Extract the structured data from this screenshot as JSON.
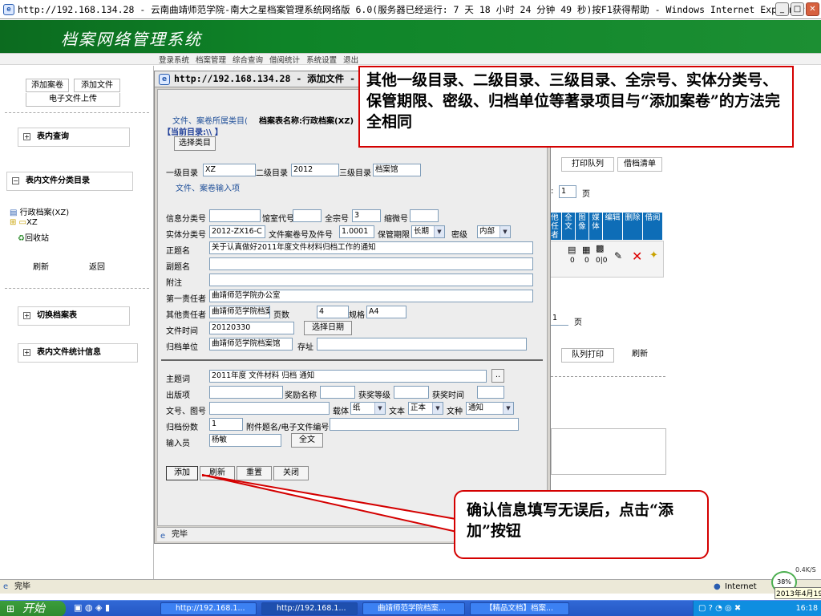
{
  "browser": {
    "title": "http://192.168.134.28 - 云南曲靖师范学院-南大之星档案管理系统网络版 6.0(服务器已经运行: 7 天 18 小时 24 分钟 49 秒)按F1获得帮助 - Windows Internet Explorer",
    "status_text": "完毕",
    "zone_text": "Internet"
  },
  "app": {
    "title": "档案网络管理系统",
    "nav": [
      "登录系统",
      "档案管理",
      "综合查询",
      "借阅统计",
      "系统设置",
      "退出"
    ]
  },
  "sidebar": {
    "add_volume": "添加案卷",
    "add_file": "添加文件",
    "e_file_upload": "电子文件上传",
    "table_query": "表内查询",
    "table_category": "表内文件分类目录",
    "tree_root": "行政档案(XZ)",
    "tree_child": "XZ",
    "tree_recycle": "回收站",
    "refresh": "刷新",
    "back": "返回",
    "switch_table": "切换档案表",
    "table_stats": "表内文件统计信息"
  },
  "background": {
    "print_queue": "打印队列",
    "loan_list": "借档清单",
    "page_prefix": ":",
    "page_value": "1",
    "page_suffix": "页",
    "grid_headers": [
      "他任者",
      "全文",
      "图像",
      "媒体",
      "编辑",
      "删除",
      "借阅"
    ],
    "counts": [
      "0",
      "0",
      "0|0"
    ],
    "page_value2": "1",
    "page_suffix2": "页",
    "queue_print": "队列打印",
    "refresh": "刷新"
  },
  "popup": {
    "title": "http://192.168.134.28 - 添加文件 - Wi",
    "category_caption": "文件、案卷所属类目(",
    "table_name_label": "档案表名称:行政档案(XZ)",
    "current_dir": "【当前目录:\\\\ 】",
    "select_category": "选择类目",
    "level1_label": "一级目录",
    "level1_value": "XZ",
    "level2_label": "二级目录",
    "level2_value": "2012",
    "level3_label": "三级目录",
    "level3_value": "档案馆",
    "input_section": "文件、案卷输入项",
    "info_class_label": "信息分类号",
    "room_code_label": "馆室代号",
    "fonds_label": "全宗号",
    "fonds_value": "3",
    "microfilm_label": "缩微号",
    "entity_class_label": "实体分类号",
    "entity_class_value": "2012-ZX16-C",
    "volume_no_label": "文件案卷号及件号",
    "volume_no_value": "1.0001",
    "retention_label": "保管期限",
    "retention_value": "长期",
    "secret_label": "密级",
    "secret_value": "内部",
    "main_title_label": "正题名",
    "main_title_value": "关于认真做好2011年度文件材料归档工作的通知",
    "sub_title_label": "副题名",
    "note_label": "附注",
    "first_resp_label": "第一责任者",
    "first_resp_value": "曲靖师范学院办公室",
    "other_resp_label": "其他责任者",
    "other_resp_value": "曲靖师范学院档案馆",
    "pages_label": "页数",
    "pages_value": "4",
    "spec_label": "规格",
    "spec_value": "A4",
    "file_time_label": "文件时间",
    "file_time_value": "20120330",
    "select_date": "选择日期",
    "archive_unit_label": "归档单位",
    "archive_unit_value": "曲靖师范学院档案馆",
    "address_label": "存址",
    "subject_label": "主题词",
    "subject_value": "2011年度  文件材料  归档  通知",
    "subject_btn": "..",
    "edition_label": "出版项",
    "award_name_label": "奖励名称",
    "award_level_label": "获奖等级",
    "award_time_label": "获奖时间",
    "doc_no_label": "文号、图号",
    "carrier_label": "载体",
    "carrier_value": "纸",
    "text_label": "文本",
    "text_value": "正本",
    "doc_type_label": "文种",
    "doc_type_value": "通知",
    "copies_label": "归档份数",
    "copies_value": "1",
    "attach_label": "附件题名/电子文件编号",
    "operator_label": "输入员",
    "operator_value": "杨敏",
    "fulltext_btn": "全文",
    "btn_add": "添加",
    "btn_refresh": "刷新",
    "btn_reset": "重置",
    "btn_close": "关闭",
    "status": "完毕"
  },
  "callouts": {
    "top": "其他一级目录、二级目录、三级目录、全宗号、实体分类号、保管期限、密级、归档单位等著录项目与“添加案卷”的方法完全相同",
    "bottom": "确认信息填写无误后，点击“添加”按钮"
  },
  "taskbar": {
    "start": "开始",
    "tasks": [
      "http://192.168.1...",
      "http://192.168.1...",
      "曲靖师范学院档案...",
      "【精品文档】档案..."
    ],
    "time": "16:18",
    "date": "2013年4月19",
    "percent": "38%",
    "speed": "0.4K/S"
  },
  "colors": {
    "accent_green": "#0e8428",
    "callout_border": "#d40000",
    "grid_header": "#0e6db7",
    "taskbar": "#2457c4"
  }
}
